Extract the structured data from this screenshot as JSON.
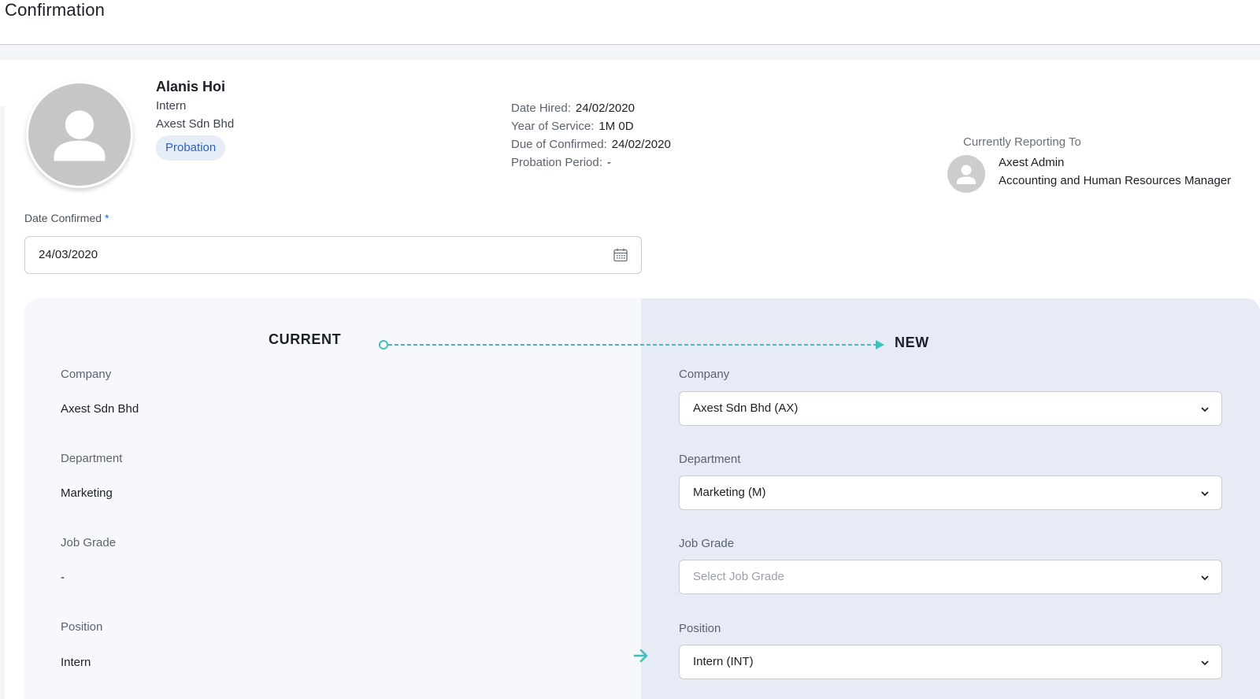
{
  "header": {
    "title": "Confirmation"
  },
  "employee": {
    "name": "Alanis Hoi",
    "position": "Intern",
    "company": "Axest Sdn Bhd",
    "status": "Probation"
  },
  "details": {
    "date_hired_label": "Date Hired:",
    "date_hired": "24/02/2020",
    "year_of_service_label": "Year of Service:",
    "year_of_service": "1M 0D",
    "due_confirmed_label": "Due of Confirmed:",
    "due_confirmed": "24/02/2020",
    "probation_period_label": "Probation Period:",
    "probation_period": "-"
  },
  "reporting": {
    "label": "Currently Reporting To",
    "name": "Axest Admin",
    "title": "Accounting and Human Resources Manager"
  },
  "date_confirmed": {
    "label": "Date Confirmed",
    "required_mark": "*",
    "value": "24/03/2020"
  },
  "comparison": {
    "current_heading": "CURRENT",
    "new_heading": "NEW",
    "current": {
      "company_label": "Company",
      "company": "Axest Sdn Bhd",
      "department_label": "Department",
      "department": "Marketing",
      "job_grade_label": "Job Grade",
      "job_grade": "-",
      "position_label": "Position",
      "position": "Intern"
    },
    "new": {
      "company_label": "Company",
      "company": "Axest Sdn Bhd (AX)",
      "department_label": "Department",
      "department": "Marketing (M)",
      "job_grade_label": "Job Grade",
      "job_grade_placeholder": "Select Job Grade",
      "position_label": "Position",
      "position": "Intern (INT)"
    }
  },
  "colors": {
    "accent_teal": "#3ec1bd",
    "badge_bg": "#e6edf8",
    "badge_text": "#2d62b8",
    "new_panel_bg": "#e6ebf6"
  }
}
